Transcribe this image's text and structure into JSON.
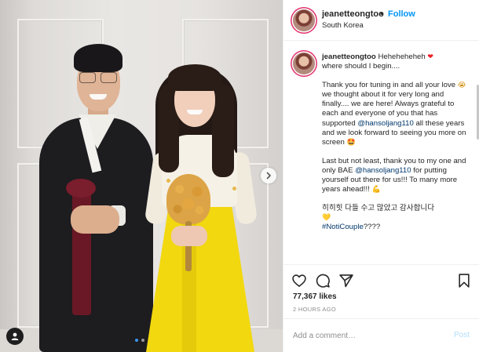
{
  "post": {
    "image_alt": "",
    "carousel": {
      "total": 2,
      "active_index": 0
    }
  },
  "header": {
    "username": "jeanetteongtoo",
    "separator": "•",
    "follow_label": "Follow",
    "location": "South Korea"
  },
  "caption": {
    "username": "jeanetteongtoo",
    "line1": "Heheheheheh",
    "line1_emoji": "❤",
    "line2": "where should I begin....",
    "p2_a": "Thank you for tuning in and all your love",
    "p2_emoji1": "😭",
    "p2_b": "we thought about it for very long and finally.... we are here! Always grateful to each and everyone of you that has supported",
    "mention": "@hansoljang110",
    "p2_c": "all these years and we look forward to seeing you more on screen",
    "p2_emoji2": "🤩",
    "p3_a": "Last but not least, thank you to my one and only BAE",
    "p3_mention": "@hansoljang110",
    "p3_b": "for putting yourself out there for us!!! To many more years ahead!!!",
    "p3_emoji": "💪",
    "korean": "히히힛 다들 수고 많았고 감사합니다",
    "korean_emoji": "💛",
    "hashtag": "#NotiCouple",
    "hashtag_suffix": "????"
  },
  "actions": {
    "likes": "77,367 likes",
    "timestamp": "2 HOURS AGO"
  },
  "comment_box": {
    "placeholder": "Add a comment…",
    "post_label": "Post"
  },
  "icons": {
    "like": "heart-outline-icon",
    "comment": "speech-bubble-icon",
    "share": "paper-plane-icon",
    "save": "bookmark-icon",
    "next": "chevron-right-icon",
    "tag": "user-tag-icon"
  },
  "colors": {
    "link": "#00376b",
    "follow": "#0095f6",
    "post_disabled": "#b2dffc",
    "muted": "#8e8e8e"
  }
}
